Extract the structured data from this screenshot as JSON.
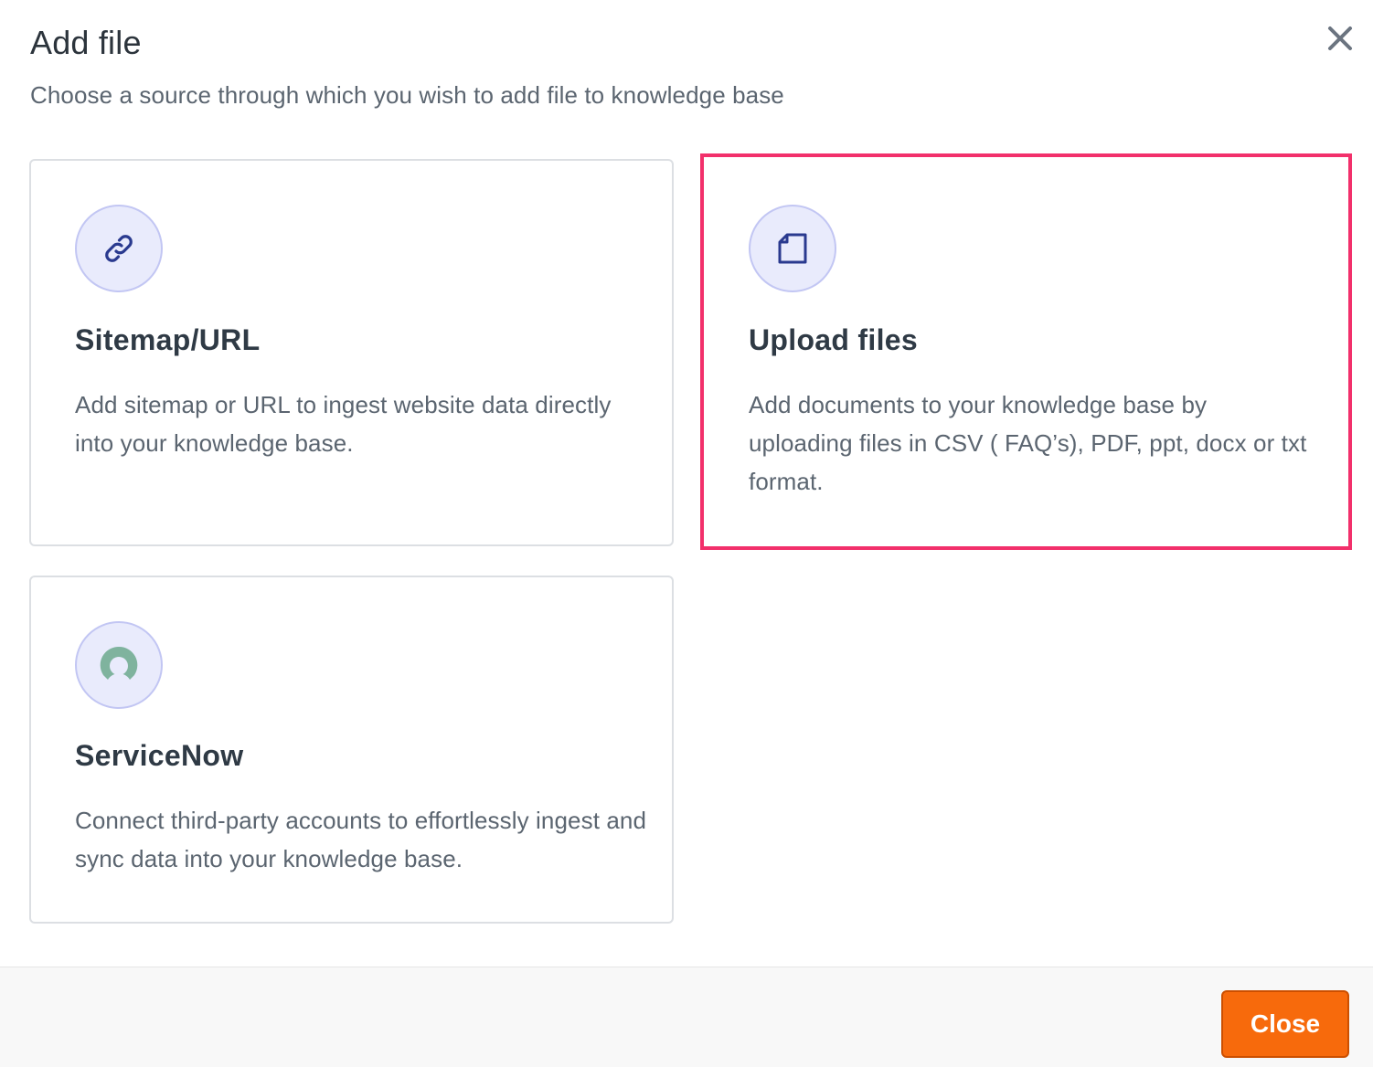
{
  "dialog": {
    "title": "Add file",
    "subtitle": "Choose a source through which you wish to add file to knowledge base",
    "close_icon": "close-icon"
  },
  "cards": [
    {
      "title": "Sitemap/URL",
      "description": "Add sitemap or URL to ingest website data directly into your knowledge base.",
      "icon": "link-icon",
      "selected": false
    },
    {
      "title": "Upload files",
      "description": "Add documents to your knowledge base by uploading files in CSV ( FAQ’s), PDF, ppt, docx or txt format.",
      "icon": "document-icon",
      "selected": true
    },
    {
      "title": "ServiceNow",
      "description": "Connect third-party accounts to effortlessly ingest and sync data into your knowledge base.",
      "icon": "servicenow-icon",
      "selected": false
    }
  ],
  "footer": {
    "close_label": "Close"
  },
  "colors": {
    "accent": "#f76a0c",
    "selection_border": "#f2306b",
    "icon_bg": "#e9ebfc",
    "icon_stroke": "#2a3a8f",
    "servicenow_green": "#7fb39e"
  }
}
